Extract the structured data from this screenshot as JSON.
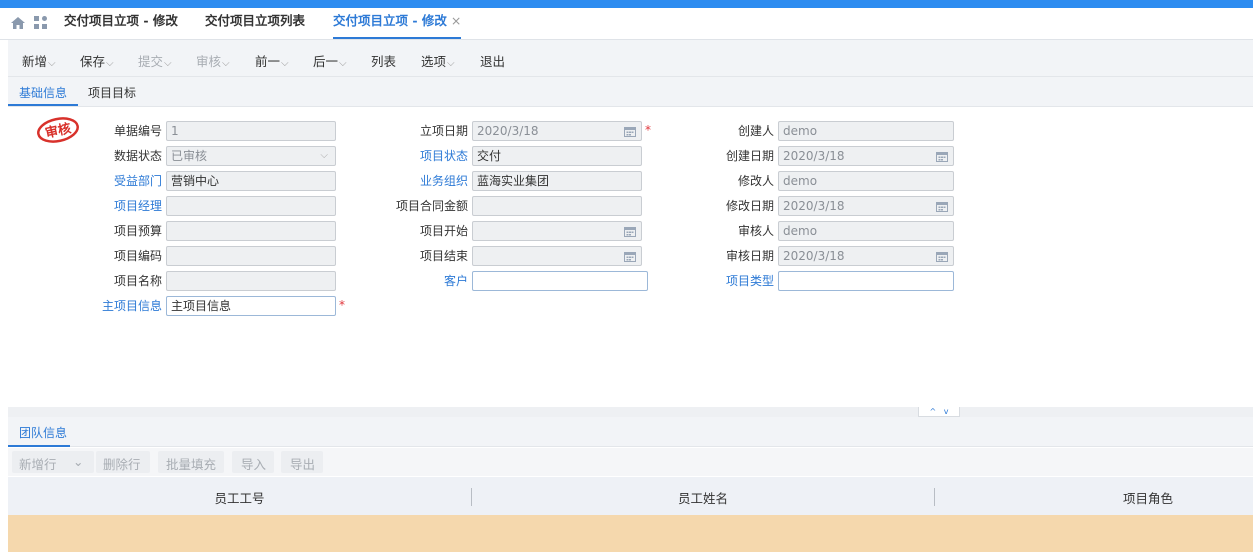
{
  "tabs": [
    {
      "label": "交付项目立项 - 修改"
    },
    {
      "label": "交付项目立项列表"
    },
    {
      "label": "交付项目立项 - 修改",
      "close": "×"
    }
  ],
  "toolbar": {
    "new": "新增",
    "save": "保存",
    "submit": "提交",
    "audit": "审核",
    "prev": "前一",
    "next": "后一",
    "list": "列表",
    "options": "选项",
    "exit": "退出"
  },
  "subtabs": [
    "基础信息",
    "项目目标"
  ],
  "stamp": "审核",
  "form": {
    "col1": [
      {
        "label": "单据编号",
        "value": "1"
      },
      {
        "label": "数据状态",
        "value": "已审核"
      },
      {
        "label": "受益部门",
        "value": "营销中心"
      },
      {
        "label": "项目经理",
        "value": ""
      },
      {
        "label": "项目预算",
        "value": ""
      },
      {
        "label": "项目编码",
        "value": ""
      },
      {
        "label": "项目名称",
        "value": ""
      },
      {
        "label": "主项目信息",
        "value": "主项目信息"
      }
    ],
    "col2": [
      {
        "label": "立项日期",
        "value": "2020/3/18"
      },
      {
        "label": "项目状态",
        "value": "交付"
      },
      {
        "label": "业务组织",
        "value": "蓝海实业集团"
      },
      {
        "label": "项目合同金额",
        "value": ""
      },
      {
        "label": "项目开始",
        "value": ""
      },
      {
        "label": "项目结束",
        "value": ""
      },
      {
        "label": "客户",
        "value": ""
      }
    ],
    "col3": [
      {
        "label": "创建人",
        "value": "demo"
      },
      {
        "label": "创建日期",
        "value": "2020/3/18"
      },
      {
        "label": "修改人",
        "value": "demo"
      },
      {
        "label": "修改日期",
        "value": "2020/3/18"
      },
      {
        "label": "审核人",
        "value": "demo"
      },
      {
        "label": "审核日期",
        "value": "2020/3/18"
      },
      {
        "label": "项目类型",
        "value": ""
      }
    ],
    "required_mark": "*"
  },
  "splitter": {
    "up": "^",
    "down": "v"
  },
  "team": {
    "tab": "团队信息",
    "buttons": {
      "add_row": "新增行",
      "add_caret": "⌄",
      "delete_row": "删除行",
      "batch_fill": "批量填充",
      "import": "导入",
      "export": "导出"
    },
    "columns": [
      "员工工号",
      "员工姓名",
      "项目角色"
    ]
  },
  "colors": {
    "accent": "#2d7ad6",
    "topbar": "#2d8cf0",
    "selected_row": "#f5d8ad",
    "stamp": "#d8312b"
  }
}
